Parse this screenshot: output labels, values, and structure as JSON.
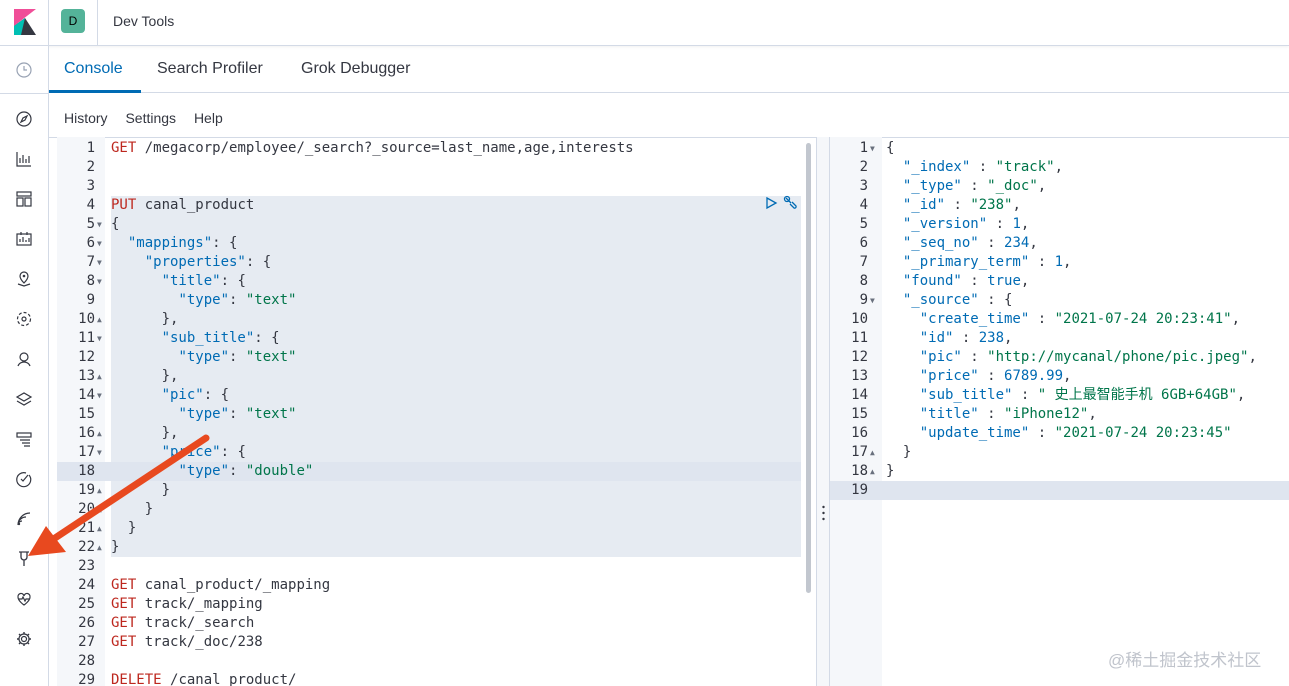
{
  "header": {
    "app_title": "Dev Tools",
    "space_initial": "D"
  },
  "sidebar": {
    "items": [
      {
        "icon": "clock-icon"
      },
      {
        "icon": "compass-icon"
      },
      {
        "icon": "visualize-icon"
      },
      {
        "icon": "dashboard-icon"
      },
      {
        "icon": "canvas-icon"
      },
      {
        "icon": "maps-icon"
      },
      {
        "icon": "ml-icon"
      },
      {
        "icon": "graph-icon"
      },
      {
        "icon": "infrastructure-icon"
      },
      {
        "icon": "logs-icon"
      },
      {
        "icon": "apm-icon"
      },
      {
        "icon": "uptime-icon"
      },
      {
        "icon": "dev-tools-icon"
      },
      {
        "icon": "monitoring-icon"
      },
      {
        "icon": "management-gear-icon"
      }
    ]
  },
  "tabs": [
    {
      "label": "Console"
    },
    {
      "label": "Search Profiler"
    },
    {
      "label": "Grok Debugger"
    }
  ],
  "menu": {
    "history": "History",
    "settings": "Settings",
    "help": "Help"
  },
  "request_editor": {
    "lines": [
      "GET /megacorp/employee/_search?_source=last_name,age,interests",
      "",
      "",
      "PUT canal_product",
      "{",
      "  \"mappings\": {",
      "    \"properties\": {",
      "      \"title\": {",
      "        \"type\": \"text\"",
      "      },",
      "      \"sub_title\": {",
      "        \"type\": \"text\"",
      "      },",
      "      \"pic\": {",
      "        \"type\": \"text\"",
      "      },",
      "      \"price\": {",
      "        \"type\": \"double\"",
      "      }",
      "    }",
      "  }",
      "}",
      "",
      "GET canal_product/_mapping",
      "GET track/_mapping",
      "GET track/_search",
      "GET track/_doc/238",
      "",
      "DELETE /canal_product/"
    ]
  },
  "response_editor": {
    "lines": [
      "{",
      "  \"_index\" : \"track\",",
      "  \"_type\" : \"_doc\",",
      "  \"_id\" : \"238\",",
      "  \"_version\" : 1,",
      "  \"_seq_no\" : 234,",
      "  \"_primary_term\" : 1,",
      "  \"found\" : true,",
      "  \"_source\" : {",
      "    \"create_time\" : \"2021-07-24 20:23:41\",",
      "    \"id\" : 238,",
      "    \"pic\" : \"http://mycanal/phone/pic.jpeg\",",
      "    \"price\" : 6789.99,",
      "    \"sub_title\" : \" 史上最智能手机 6GB+64GB\",",
      "    \"title\" : \"iPhone12\",",
      "    \"update_time\" : \"2021-07-24 20:23:45\"",
      "  }",
      "}",
      ""
    ]
  },
  "watermark": "@稀土掘金技术社区",
  "colors": {
    "accent": "#006bb4",
    "arrow": "#e8491f",
    "method": "#bd271e",
    "string": "#00754a"
  }
}
